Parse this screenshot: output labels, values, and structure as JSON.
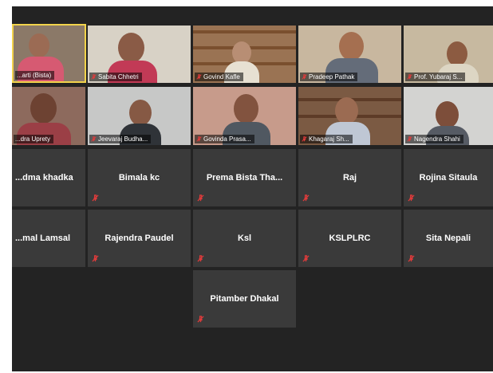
{
  "participants": {
    "video": [
      {
        "name": "...arti (Bista)",
        "muted": false,
        "active": true
      },
      {
        "name": "Sabita Chhetri",
        "muted": true,
        "active": false
      },
      {
        "name": "Govind Kafle",
        "muted": true,
        "active": false
      },
      {
        "name": "Pradeep Pathak",
        "muted": true,
        "active": false
      },
      {
        "name": "Prof. Yubaraj S...",
        "muted": true,
        "active": false
      },
      {
        "name": "...dra Uprety",
        "muted": false,
        "active": false
      },
      {
        "name": "Jeevaraj Budha...",
        "muted": true,
        "active": false
      },
      {
        "name": "Govinda Prasa...",
        "muted": true,
        "active": false
      },
      {
        "name": "Khagaraj Sh...",
        "muted": true,
        "active": false
      },
      {
        "name": "Nagendra Shahi",
        "muted": true,
        "active": false
      }
    ],
    "audio_only": [
      {
        "name": "...dma khadka",
        "muted": false
      },
      {
        "name": "Bimala kc",
        "muted": true
      },
      {
        "name": "Prema Bista Tha...",
        "muted": true
      },
      {
        "name": "Raj",
        "muted": true
      },
      {
        "name": "Rojina Sitaula",
        "muted": true
      },
      {
        "name": "...mal Lamsal",
        "muted": false
      },
      {
        "name": "Rajendra Paudel",
        "muted": true
      },
      {
        "name": "Ksl",
        "muted": true
      },
      {
        "name": "KSLPLRC",
        "muted": true
      },
      {
        "name": "Sita Nepali",
        "muted": true
      },
      {
        "name": "Pitamber Dhakal",
        "muted": true
      }
    ]
  },
  "colors": {
    "background": "#232323",
    "tile": "#3a3a3a",
    "active_border": "#f2d34b",
    "muted_icon": "#e03b3b",
    "name_text": "#ffffff"
  },
  "icons": {
    "muted": "microphone-muted-icon"
  }
}
